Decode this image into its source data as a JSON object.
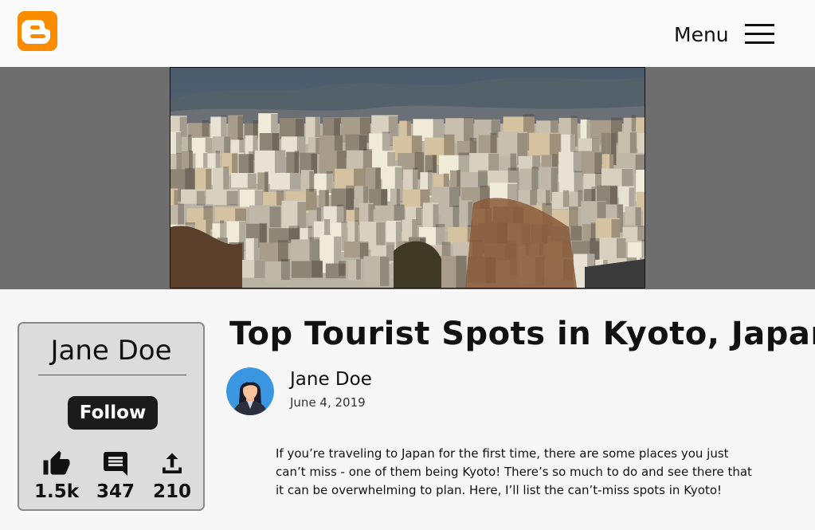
{
  "header": {
    "logo_icon": "blogger-logo-icon",
    "menu_label": "Menu",
    "menu_icon": "hamburger-menu-icon",
    "brand_color": "#fb8c00"
  },
  "hero": {
    "image_description_icon": "city-skyline-photo"
  },
  "author_card": {
    "name": "Jane Doe",
    "follow_label": "Follow",
    "stats": [
      {
        "icon": "thumbs-up-icon",
        "value": "1.5k"
      },
      {
        "icon": "comment-icon",
        "value": "347"
      },
      {
        "icon": "share-icon",
        "value": "210"
      }
    ]
  },
  "article": {
    "title": "Top Tourist Spots in Kyoto, Japan",
    "author": "Jane Doe",
    "date": "June 4, 2019",
    "body": "If you’re traveling to Japan for the first time, there are some places you just can’t miss - one of them being Kyoto! There’s so much to do and see there that it can be overwhelming to plan. Here, I’ll list the can’t-miss spots in Kyoto!"
  }
}
